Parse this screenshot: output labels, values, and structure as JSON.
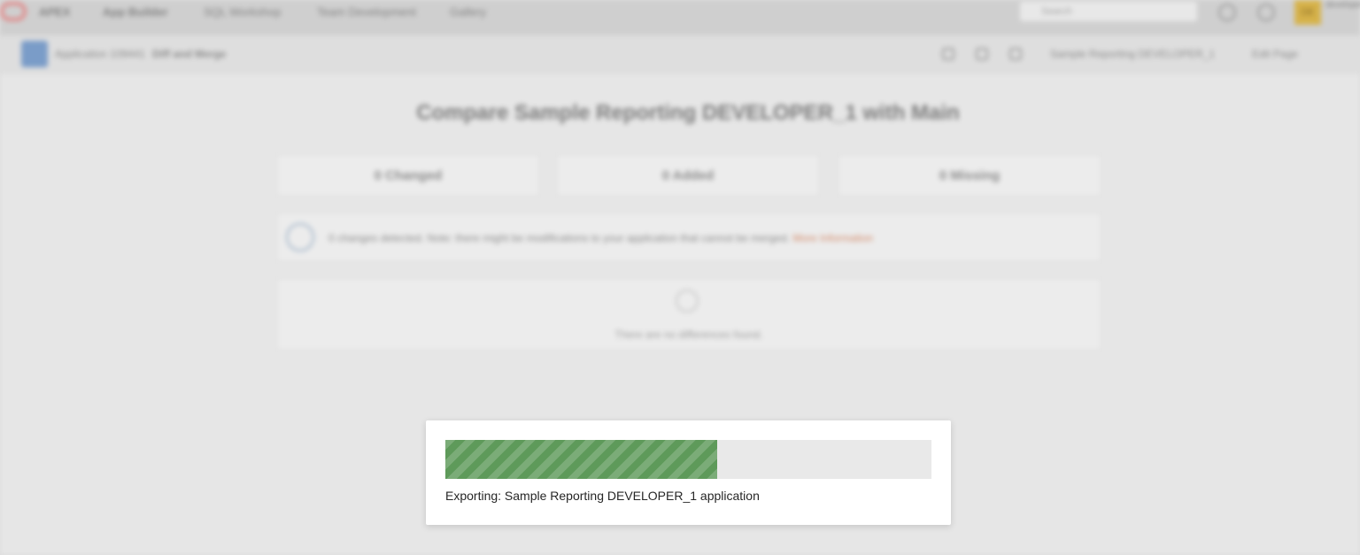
{
  "topbar": {
    "brand": "APEX",
    "nav_items": [
      "App Builder",
      "SQL Workshop",
      "Team Development",
      "Gallery"
    ],
    "search_placeholder": "Search",
    "avatar_initials": "DE",
    "user_name": "developer"
  },
  "subbar": {
    "breadcrumb_app": "Application 109441",
    "breadcrumb_page": "Diff and Merge",
    "branch_label": "Sample Reporting DEVELOPER_1",
    "edit_page_label": "Edit Page"
  },
  "main": {
    "title": "Compare Sample Reporting DEVELOPER_1 with Main",
    "stats": [
      {
        "label": "0 Changed"
      },
      {
        "label": "0 Added"
      },
      {
        "label": "0 Missing"
      }
    ],
    "info": {
      "text": "0 changes detected. Note: there might be modifications to your application that cannot be merged.",
      "link": "More Information"
    },
    "empty_message": "There are no differences found."
  },
  "modal": {
    "progress_percent": 56,
    "label": "Exporting: Sample Reporting DEVELOPER_1 application"
  },
  "colors": {
    "progress_fill": "#5e9a5a",
    "progress_track": "#e9e9e9"
  }
}
